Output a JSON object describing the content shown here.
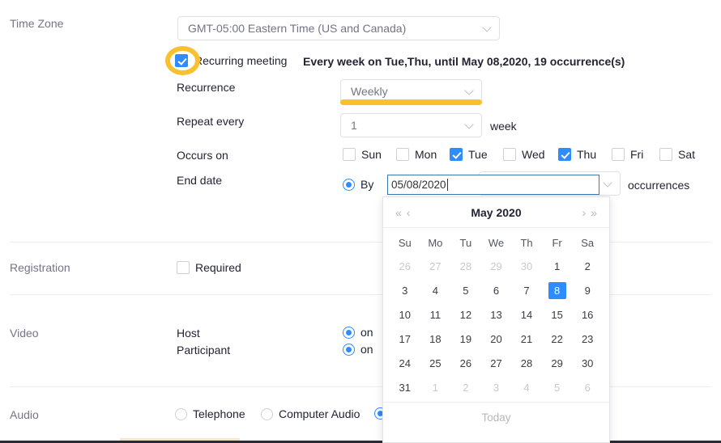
{
  "form": {
    "timezone": {
      "label": "Time Zone",
      "value": "GMT-05:00 Eastern Time (US and Canada)"
    },
    "recurring": {
      "label": "Recurring meeting",
      "checked": true,
      "summary": "Every week on Tue,Thu, until May 08,2020, 19 occurrence(s)"
    },
    "recurrence": {
      "label": "Recurrence",
      "value": "Weekly"
    },
    "repeat_every": {
      "label": "Repeat every",
      "value": "1",
      "unit": "week"
    },
    "occurs_on": {
      "label": "Occurs on",
      "days": [
        {
          "name": "Sun",
          "checked": false
        },
        {
          "name": "Mon",
          "checked": false
        },
        {
          "name": "Tue",
          "checked": true
        },
        {
          "name": "Wed",
          "checked": false
        },
        {
          "name": "Thu",
          "checked": true
        },
        {
          "name": "Fri",
          "checked": false
        },
        {
          "name": "Sat",
          "checked": false
        }
      ]
    },
    "end_date": {
      "label": "End date",
      "by_label": "By",
      "by_selected": true,
      "date_value": "05/08/2020",
      "occurrences_label": "occurrences"
    },
    "registration": {
      "label": "Registration",
      "required_label": "Required",
      "required_checked": false
    },
    "video": {
      "label": "Video",
      "rows": [
        {
          "label": "Host",
          "state": "on",
          "selected": true
        },
        {
          "label": "Participant",
          "state": "on",
          "selected": true
        }
      ]
    },
    "audio": {
      "label": "Audio",
      "options": [
        {
          "label": "Telephone",
          "selected": false
        },
        {
          "label": "Computer Audio",
          "selected": false
        },
        {
          "label": "",
          "selected": true
        }
      ]
    }
  },
  "calendar": {
    "title": "May 2020",
    "nav": {
      "prev_year": "«",
      "prev_month": "‹",
      "next_month": "›",
      "next_year": "»"
    },
    "weekdays": [
      "Su",
      "Mo",
      "Tu",
      "We",
      "Th",
      "Fr",
      "Sa"
    ],
    "weeks": [
      [
        {
          "d": "26",
          "muted": true
        },
        {
          "d": "27",
          "muted": true
        },
        {
          "d": "28",
          "muted": true
        },
        {
          "d": "29",
          "muted": true
        },
        {
          "d": "30",
          "muted": true
        },
        {
          "d": "1",
          "muted": false
        },
        {
          "d": "2",
          "muted": false
        }
      ],
      [
        {
          "d": "3",
          "muted": false
        },
        {
          "d": "4",
          "muted": false
        },
        {
          "d": "5",
          "muted": false
        },
        {
          "d": "6",
          "muted": false
        },
        {
          "d": "7",
          "muted": false
        },
        {
          "d": "8",
          "muted": false,
          "selected": true
        },
        {
          "d": "9",
          "muted": false
        }
      ],
      [
        {
          "d": "10",
          "muted": false
        },
        {
          "d": "11",
          "muted": false
        },
        {
          "d": "12",
          "muted": false
        },
        {
          "d": "13",
          "muted": false
        },
        {
          "d": "14",
          "muted": false
        },
        {
          "d": "15",
          "muted": false
        },
        {
          "d": "16",
          "muted": false
        }
      ],
      [
        {
          "d": "17",
          "muted": false
        },
        {
          "d": "18",
          "muted": false
        },
        {
          "d": "19",
          "muted": false
        },
        {
          "d": "20",
          "muted": false
        },
        {
          "d": "21",
          "muted": false
        },
        {
          "d": "22",
          "muted": false
        },
        {
          "d": "23",
          "muted": false
        }
      ],
      [
        {
          "d": "24",
          "muted": false
        },
        {
          "d": "25",
          "muted": false
        },
        {
          "d": "26",
          "muted": false
        },
        {
          "d": "27",
          "muted": false
        },
        {
          "d": "28",
          "muted": false
        },
        {
          "d": "29",
          "muted": false
        },
        {
          "d": "30",
          "muted": false
        }
      ],
      [
        {
          "d": "31",
          "muted": false
        },
        {
          "d": "1",
          "muted": true
        },
        {
          "d": "2",
          "muted": true
        },
        {
          "d": "3",
          "muted": true
        },
        {
          "d": "4",
          "muted": true
        },
        {
          "d": "5",
          "muted": true
        },
        {
          "d": "6",
          "muted": true
        }
      ]
    ],
    "today_label": "Today"
  },
  "colors": {
    "accent_blue": "#2d8cff",
    "highlight_yellow": "#fbc02d",
    "label_gray": "#747487",
    "border_gray": "#e0e0e6"
  }
}
